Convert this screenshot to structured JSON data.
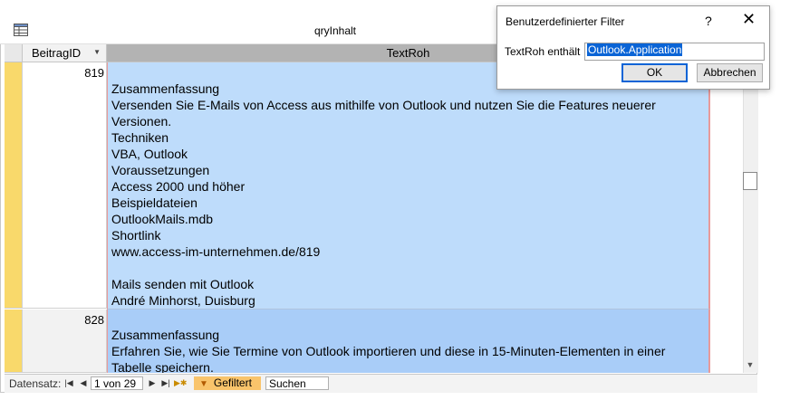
{
  "window": {
    "title": "qryInhalt"
  },
  "columns": {
    "id_header": "BeitragID",
    "text_header": "TextRoh"
  },
  "rows": [
    {
      "id": "819",
      "lines": [
        "Zusammenfassung",
        "Versenden Sie E-Mails von Access aus mithilfe von Outlook und nutzen Sie die Features neuerer",
        "Versionen.",
        "Techniken",
        "VBA, Outlook",
        "Voraussetzungen",
        "Access 2000 und höher",
        "Beispieldateien",
        "OutlookMails.mdb",
        "Shortlink",
        "www.access-im-unternehmen.de/819",
        "",
        "Mails senden mit Outlook",
        "André Minhorst, Duisburg"
      ]
    },
    {
      "id": "828",
      "lines": [
        "Zusammenfassung",
        "Erfahren Sie, wie Sie Termine von Outlook importieren und diese in 15-Minuten-Elementen in einer",
        "Tabelle speichern."
      ]
    }
  ],
  "navigation": {
    "label": "Datensatz:",
    "record": "1 von 29",
    "filter_label": "Gefiltert",
    "search_label": "Suchen"
  },
  "dialog": {
    "title": "Benutzerdefinierter Filter",
    "help": "?",
    "close": "✕",
    "field_label": "TextRoh  enthält",
    "value": "Outlook.Application",
    "ok_label": "OK",
    "cancel_label": "Abbrechen"
  }
}
